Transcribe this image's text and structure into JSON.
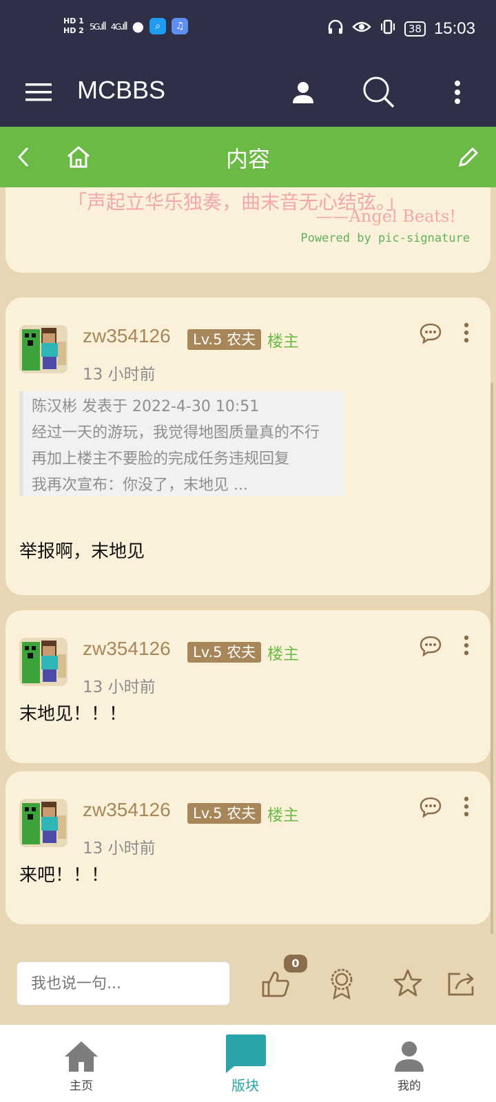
{
  "status_bar": {
    "hd1": "HD 1",
    "hd2": "HD 2",
    "net1": "5G",
    "net2": "4G",
    "battery": "38",
    "time": "15:03"
  },
  "app_bar": {
    "title": "MCBBS"
  },
  "sub_bar": {
    "title": "内容"
  },
  "signature": {
    "quote": "「声起立华乐独奏，曲末音无心结弦。」",
    "author": "——Angel Beats!",
    "powered": "Powered by pic-signature"
  },
  "posts": [
    {
      "username": "zw354126",
      "level": "Lv.5 农夫",
      "badge": "楼主",
      "time": "13 小时前",
      "quote": {
        "header": "陈汉彬 发表于 2022-4-30 10:51",
        "lines": [
          "经过一天的游玩，我觉得地图质量真的不行",
          "再加上楼主不要脸的完成任务违规回复",
          "我再次宣布：你没了，末地见 ..."
        ]
      },
      "text": "举报啊，末地见"
    },
    {
      "username": "zw354126",
      "level": "Lv.5 农夫",
      "badge": "楼主",
      "time": "13 小时前",
      "text": "末地见！！！"
    },
    {
      "username": "zw354126",
      "level": "Lv.5 农夫",
      "badge": "楼主",
      "time": "13 小时前",
      "text": "来吧！！！"
    }
  ],
  "action_bar": {
    "input_placeholder": "我也说一句...",
    "like_count": "0"
  },
  "bottom_nav": [
    {
      "label": "主页",
      "icon": "home-icon"
    },
    {
      "label": "版块",
      "icon": "chat-bubble-icon",
      "active": true
    },
    {
      "label": "我的",
      "icon": "person-icon"
    }
  ],
  "colors": {
    "header": "#2e3047",
    "green": "#6aba45",
    "card": "#fbf0d9",
    "background": "#e6d6b3",
    "brown": "#a7875a",
    "teal": "#2aa3a9"
  }
}
